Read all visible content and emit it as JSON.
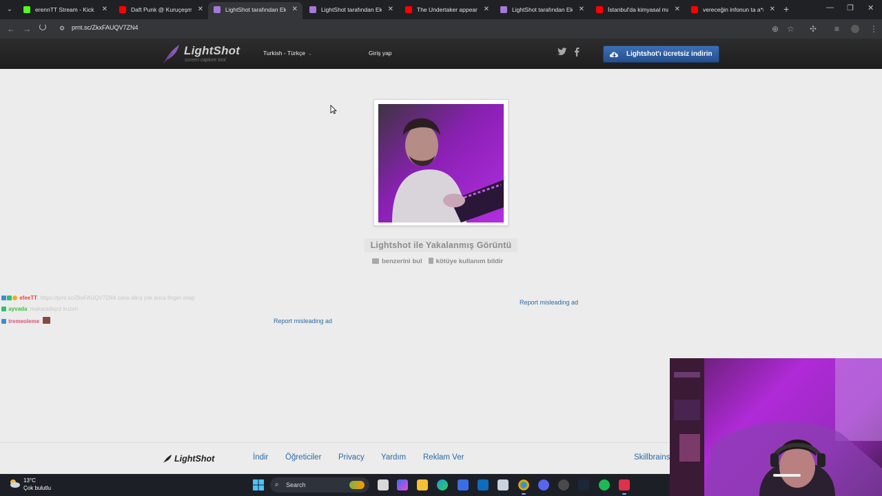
{
  "browser": {
    "tabs": [
      {
        "title": "erennTT Stream - Kick Da",
        "favicon_color": "#53fc18",
        "active": false
      },
      {
        "title": "Daft Punk @ Kuruçeşme /",
        "favicon_color": "#ff0000",
        "active": false
      },
      {
        "title": "LightShot tarafından Ekra",
        "favicon_color": "#a678d8",
        "active": true
      },
      {
        "title": "LightShot tarafından Ekra",
        "favicon_color": "#a678d8",
        "active": false
      },
      {
        "title": "The Undertaker appears !",
        "favicon_color": "#ff0000",
        "active": false
      },
      {
        "title": "LightShot tarafından Ekra",
        "favicon_color": "#a678d8",
        "active": false
      },
      {
        "title": "İstanbul'da kimyasal mad",
        "favicon_color": "#ff0000",
        "active": false
      },
      {
        "title": "vereceğin infonun ta a*n",
        "favicon_color": "#ff0000",
        "active": false
      }
    ],
    "new_tab": "+",
    "address": "prnt.sc/ZkxFAUQV7ZN4"
  },
  "header": {
    "logo": "LightShot",
    "logo_sub": "screen capture tool",
    "language": "Turkish - Türkçe",
    "login": "Giriş yap",
    "twitter": "twitter-icon",
    "facebook": "facebook-icon",
    "download_label": "Lightshot'ı ücretsiz indirin"
  },
  "main": {
    "image_title": "Lightshot ile Yakalanmış Görüntü",
    "find_similar": "benzerini bul",
    "report_abuse": "kötüye kullanım bildir",
    "report_ad_1": "Report misleading ad",
    "report_ad_2": "Report misleading ad"
  },
  "chat": [
    {
      "name": "efeeTT",
      "name_color": "#ff3b3b",
      "message": ": https://prnt.sc/ZkxFAUQV7ZN4 cana alkış yok anca finger snap"
    },
    {
      "name": "ayvada",
      "name_color": "#3fbf3f",
      "message": ": makaradayız kuzen"
    },
    {
      "name": "tremeoleme",
      "name_color": "#e0507a",
      "message": ":"
    }
  ],
  "footer": {
    "logo": "LightShot",
    "links": [
      "İndir",
      "Öğreticiler",
      "Privacy",
      "Yardım",
      "Reklam Ver"
    ],
    "skillbrains": "Skillbrains"
  },
  "taskbar": {
    "temperature": "13°C",
    "condition": "Çok bulutlu",
    "search": "Search"
  },
  "colors": {
    "accent_blue": "#2a6aa5",
    "download_button": "#2f5fa3",
    "header_bg": "#262626"
  }
}
